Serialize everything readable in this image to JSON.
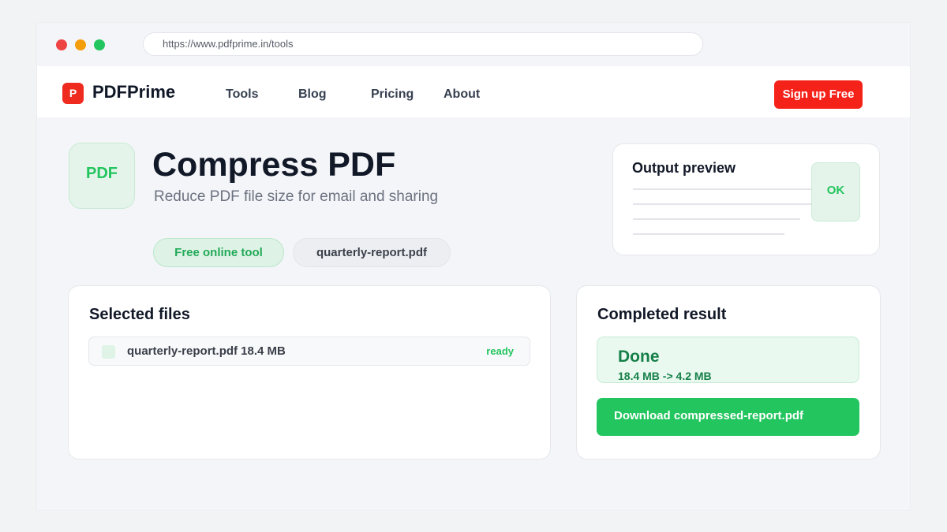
{
  "browser": {
    "url": "https://www.pdfprime.in/tools"
  },
  "brand": {
    "logo_letter": "P",
    "name": "PDFPrime",
    "accent": "#ef2b1f"
  },
  "nav": {
    "links": [
      "Tools",
      "Blog",
      "Pricing",
      "About"
    ],
    "signup_label": "Sign up Free"
  },
  "tool": {
    "icon_label": "PDF",
    "title": "Compress PDF",
    "subtitle": "Reduce PDF file size for email and sharing",
    "chips": [
      "Free online tool",
      "quarterly-report.pdf"
    ]
  },
  "preview": {
    "title": "Output preview",
    "badge": "OK"
  },
  "selected_files": {
    "heading": "Selected files",
    "items": [
      {
        "name": "quarterly-report.pdf 18.4 MB",
        "status": "ready"
      }
    ]
  },
  "result": {
    "heading": "Completed result",
    "status_title": "Done",
    "size_change": "18.4 MB -> 4.2 MB",
    "download_label": "Download compressed-report.pdf",
    "accent": "#22c55e"
  }
}
